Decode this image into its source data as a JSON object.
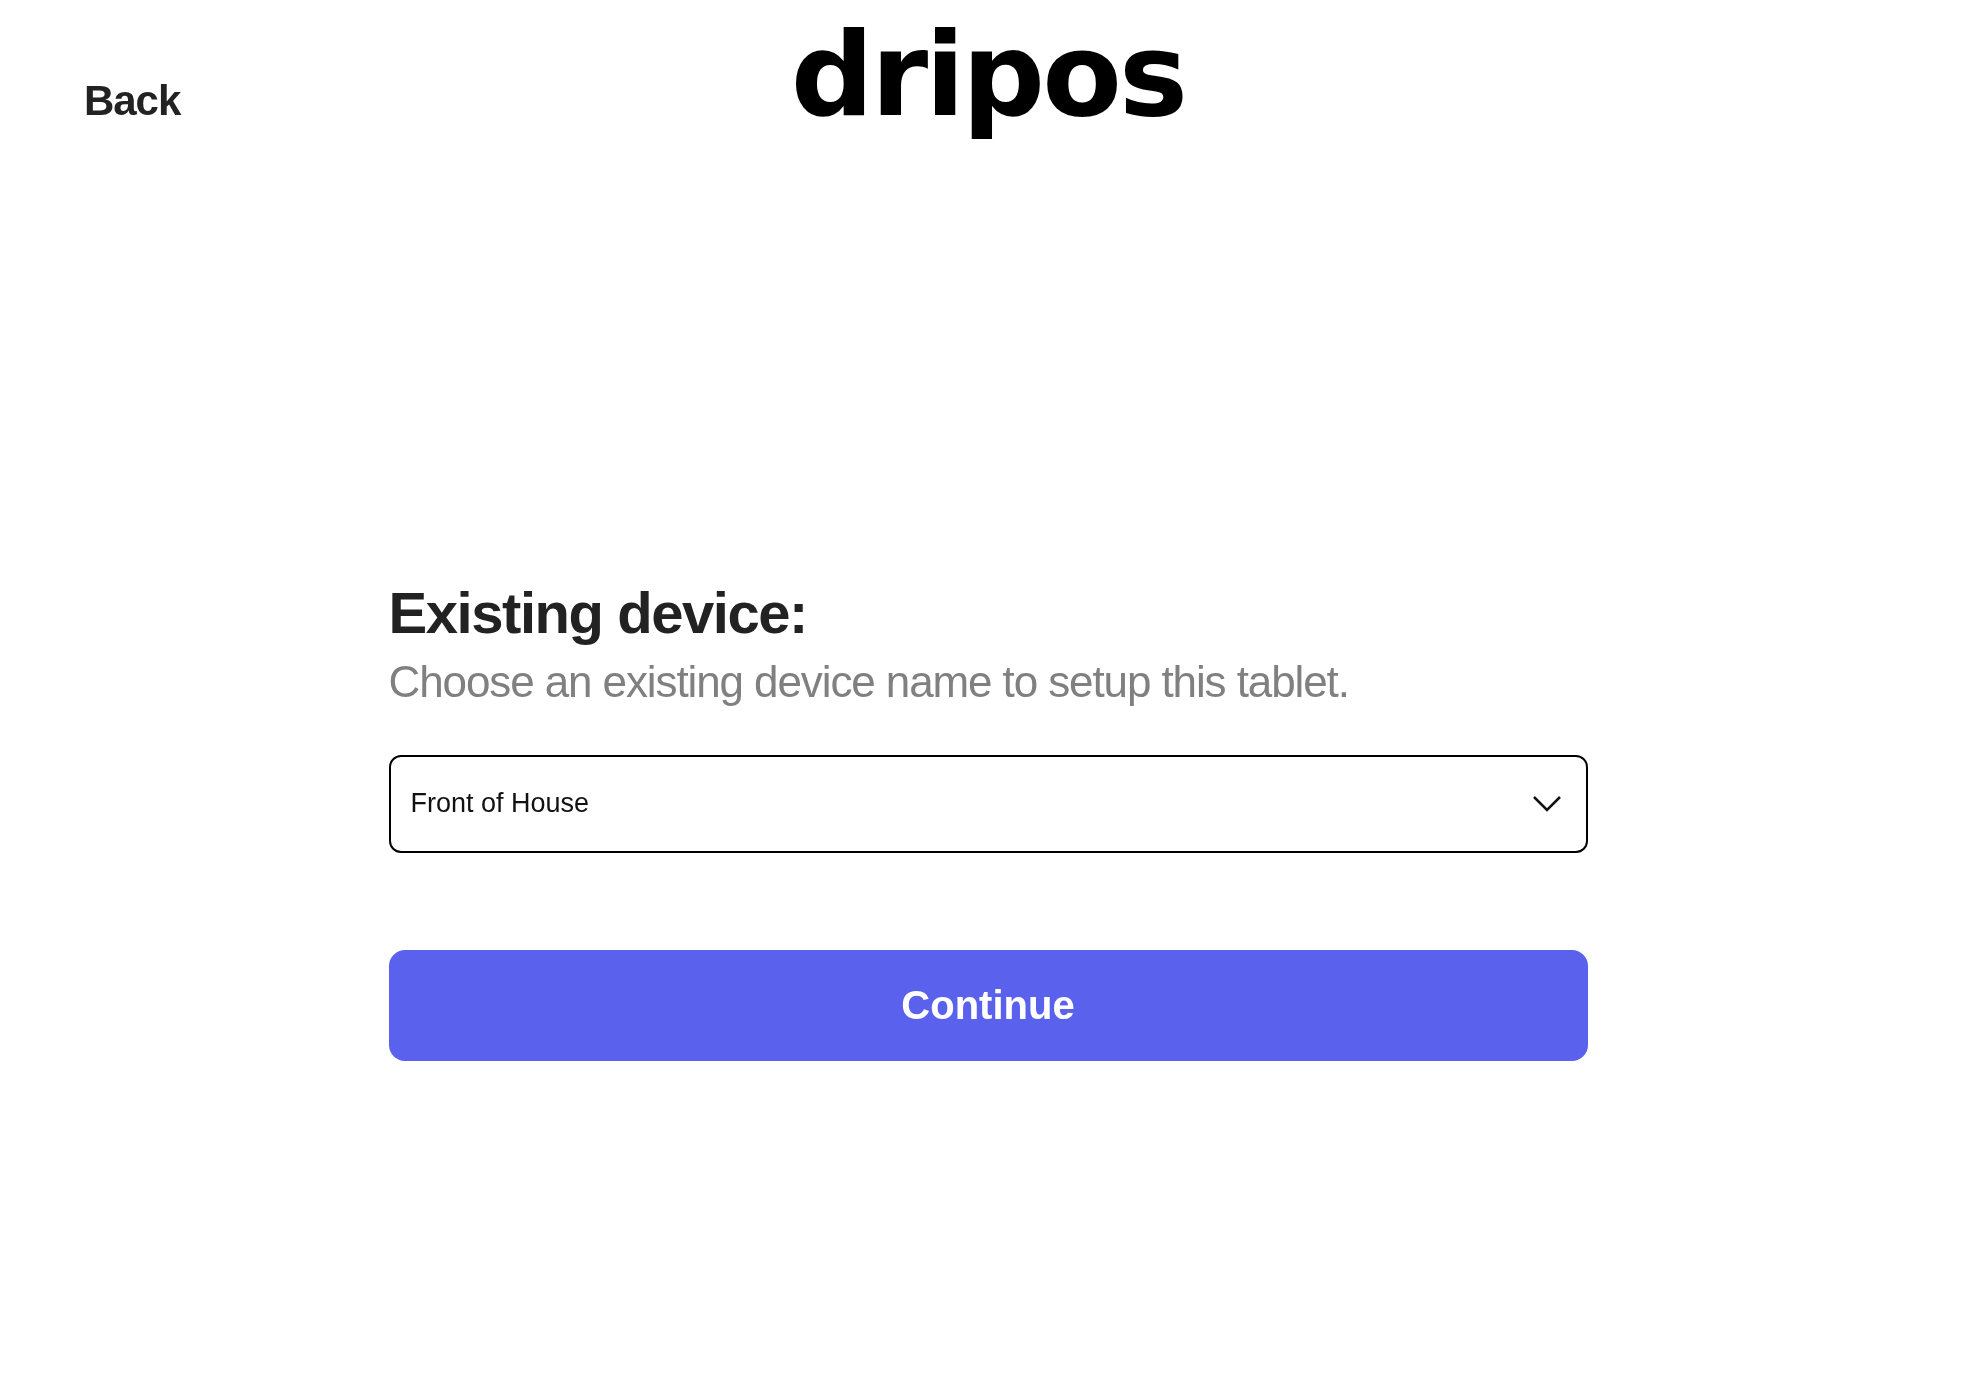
{
  "header": {
    "back": "Back",
    "logo": "dripos"
  },
  "heading": "Existing device:",
  "subtitle": "Choose an existing device name to setup this tablet.",
  "device_select": {
    "value": "Front of House"
  },
  "button": "Continue"
}
